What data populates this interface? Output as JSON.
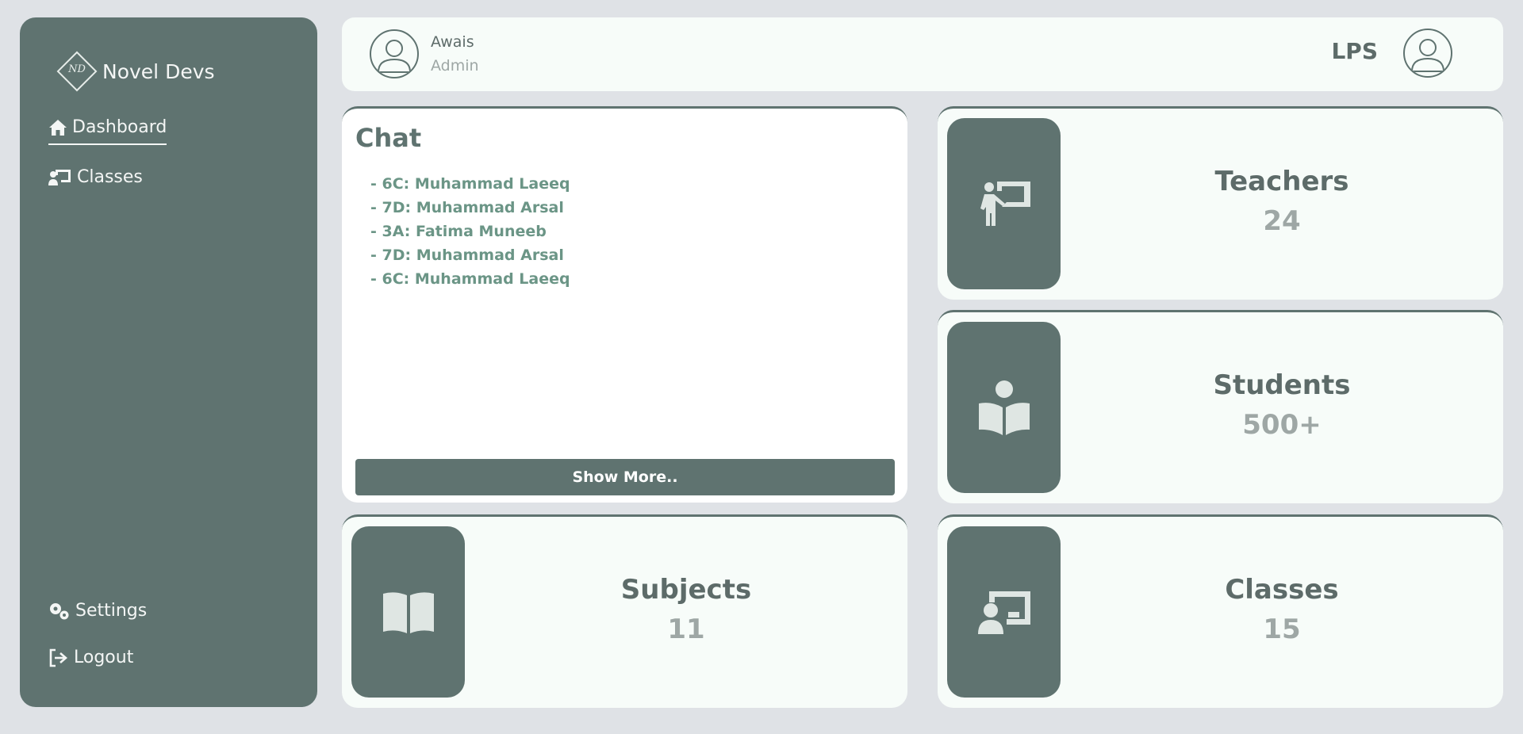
{
  "brand": {
    "name": "Novel Devs",
    "monogram": "ND"
  },
  "sidebar": {
    "items": [
      {
        "label": "Dashboard",
        "icon": "home-icon",
        "active": true
      },
      {
        "label": "Classes",
        "icon": "chalkboard-teacher-icon"
      }
    ],
    "bottom_items": [
      {
        "label": "Settings",
        "icon": "gears-icon"
      },
      {
        "label": "Logout",
        "icon": "logout-icon"
      }
    ]
  },
  "header": {
    "user_name": "Awais",
    "user_role": "Admin",
    "school": "LPS"
  },
  "chat": {
    "title": "Chat",
    "messages": [
      "- 6C: Muhammad Laeeq",
      "- 7D: Muhammad Arsal",
      "- 3A: Fatima Muneeb",
      "- 7D: Muhammad Arsal",
      "- 6C: Muhammad Laeeq"
    ],
    "show_more_label": "Show More.."
  },
  "stats": {
    "teachers": {
      "label": "Teachers",
      "value": "24",
      "icon": "person-chalkboard-icon"
    },
    "students": {
      "label": "Students",
      "value": "500+",
      "icon": "book-reader-icon"
    },
    "subjects": {
      "label": "Subjects",
      "value": "11",
      "icon": "open-book-icon"
    },
    "classes": {
      "label": "Classes",
      "value": "15",
      "icon": "chalkboard-user-icon"
    }
  },
  "colors": {
    "primary": "#5f7370",
    "background": "#dfe2e6",
    "card": "#f7fcf9",
    "chat_text": "#6b9586",
    "muted": "#9ea7a5"
  }
}
